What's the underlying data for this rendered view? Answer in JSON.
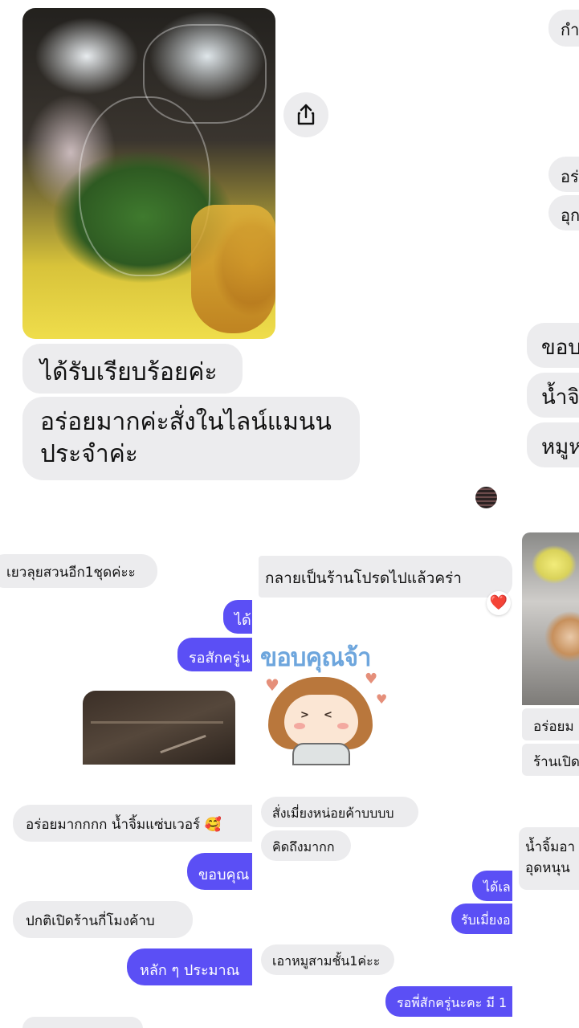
{
  "panel1": {
    "received_msg": "ได้รับเรียบร้อยค่ะ",
    "review_msg_line1": "อร่อยมากค่ะสั่งในไลน์แมนน",
    "review_msg_line2": "ประจำค่ะ"
  },
  "panel2": {
    "msgs": [
      "กำ",
      "อร่",
      "อุก",
      "ขอบ",
      "น้ำจิ",
      "หมูห"
    ]
  },
  "panel3": {
    "incoming_top": "เยวลุยสวนอีก1ชุดค่ะะ",
    "outgoing_1": "ได้",
    "outgoing_2": "รอสักครู่น",
    "incoming_1": "อร่อยมากกกก น้ำจิ้มแซ่บเวอร์ 🥰",
    "outgoing_3": "ขอบคุณ",
    "incoming_2": "ปกติเปิดร้านกี่โมงค้าบ",
    "outgoing_4": "หลัก ๆ ประมาณ"
  },
  "panel4": {
    "incoming_top": "กลายเป็นร้านโปรดไปแล้วคร่า",
    "reaction": "❤️",
    "sticker_text": "ขอบคุณจ้า",
    "incoming_1": "สั่งเมี่ยงหน่อยค้าบบบบ",
    "incoming_2": "คิดถึงมากก",
    "outgoing_1": "ได้เล",
    "outgoing_2": "รับเมี่ยงอ",
    "incoming_3": "เอาหมูสามชั้น1ค่ะะ",
    "outgoing_3": "รอพี่สักครู่นะคะ มี 1"
  },
  "panel5": {
    "msg_1": "อร่อยม",
    "msg_2": "ร้านเปิด",
    "msg_3_line1": "น้ำจิ้มอา",
    "msg_3_line2": "อุดหนุน"
  },
  "colors": {
    "incoming_bubble": "#ececee",
    "outgoing_bubble": "#5b4ff5",
    "heart": "#e0202c"
  }
}
